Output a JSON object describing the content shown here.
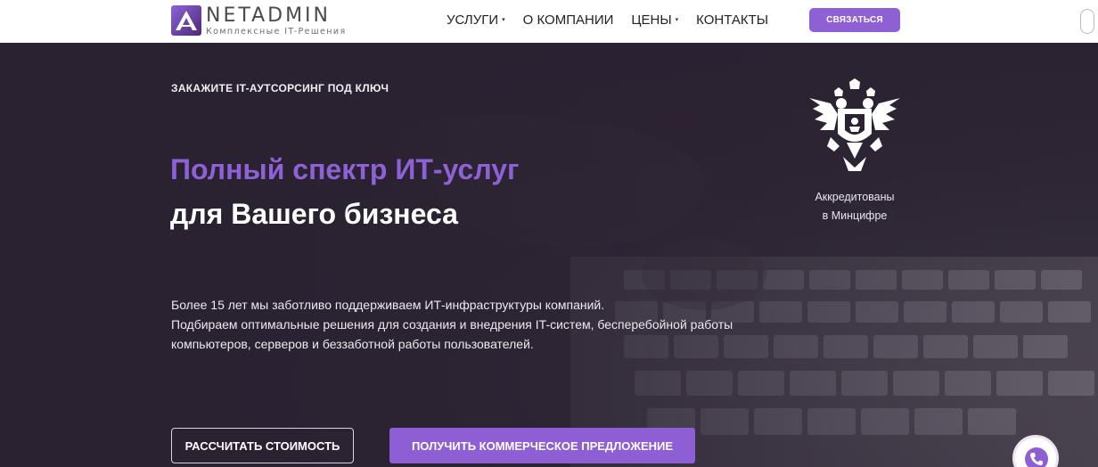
{
  "header": {
    "logo": {
      "name": "NETADMIN",
      "tagline": "Комплексные IT-Решения",
      "icon": "logo-a-mark"
    },
    "nav": [
      {
        "label": "УСЛУГИ",
        "has_dropdown": true
      },
      {
        "label": "О КОМПАНИИ",
        "has_dropdown": false
      },
      {
        "label": "ЦЕНЫ",
        "has_dropdown": true
      },
      {
        "label": "КОНТАКТЫ",
        "has_dropdown": false
      }
    ],
    "contact_button": "СВЯЗАТЬСЯ",
    "dropdown_glyph": "▾"
  },
  "hero": {
    "kicker": "ЗАКАЖИТЕ IT-АУТСОРСИНГ ПОД КЛЮЧ",
    "title_accent": "Полный спектр ИТ-услуг",
    "title_main": "для Вашего бизнеса",
    "description": [
      "Более 15 лет мы заботливо поддерживаем ИТ-инфраструктуры компаний.",
      "Подбираем оптимальные решения для создания и внедрения IT-систем, бесперебойной работы",
      "компьютеров, серверов и беззаботной работы пользователей."
    ],
    "accreditation": {
      "icon": "russian-coat-of-arms-icon",
      "line1": "Аккредитованы",
      "line2": "в Минцифре"
    },
    "buttons": {
      "calculate": "РАССЧИТАТЬ СТОИМОСТЬ",
      "offer": "ПОЛУЧИТЬ КОММЕРЧЕСКОЕ ПРЕДЛОЖЕНИЕ"
    },
    "call_widget_icon": "phone-icon"
  },
  "colors": {
    "accent": "#8e5fd4",
    "hero_background": "#2b2233",
    "header_background": "#ffffff",
    "text_light": "#ffffff"
  }
}
